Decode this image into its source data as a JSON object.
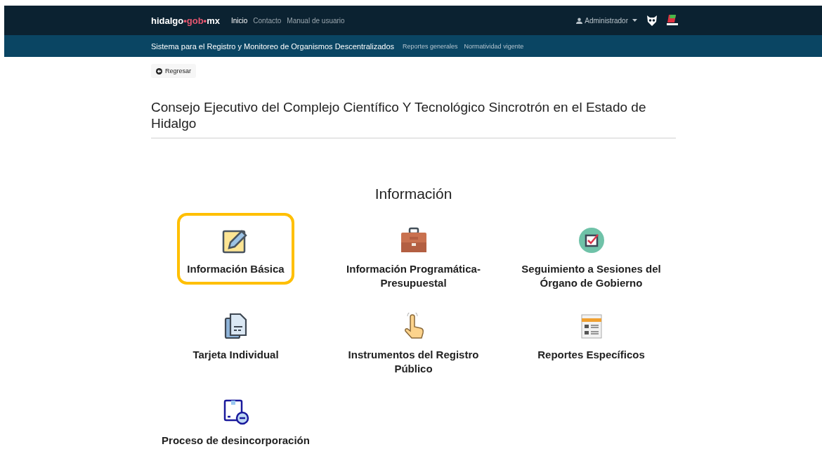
{
  "header": {
    "logo": [
      {
        "text": "hidalgo",
        "color": "#ffffff"
      },
      {
        "text": "•gob•",
        "color": "#e5566f"
      },
      {
        "text": "mx",
        "color": "#ffffff"
      }
    ],
    "nav": [
      {
        "label": "Inicio",
        "selected": true
      },
      {
        "label": "Contacto",
        "selected": false
      },
      {
        "label": "Manual de usuario",
        "selected": false
      }
    ],
    "user": "Administrador"
  },
  "subheader": {
    "title": "Sistema para el Registro y Monitoreo de Organismos Descentralizados",
    "links": [
      "Reportes generales",
      "Normatividad vigente"
    ]
  },
  "back_button": "Regresar",
  "page_title": "Consejo Ejecutivo del Complejo Científico Y Tecnológico Sincrotrón en el Estado de Hidalgo",
  "section_title": "Información",
  "cards": [
    {
      "label": "Información Básica",
      "kind": "pencil",
      "selected": true
    },
    {
      "label": "Información Programática-Presupuestal",
      "kind": "briefcase",
      "selected": false
    },
    {
      "label": "Seguimiento a Sesiones del Órgano de Gobierno",
      "kind": "check",
      "selected": false
    },
    {
      "label": "Tarjeta Individual",
      "kind": "document",
      "selected": false
    },
    {
      "label": "Instrumentos del Registro Público",
      "kind": "hand",
      "selected": false
    },
    {
      "label": "Reportes Específicos",
      "kind": "report",
      "selected": false
    },
    {
      "label": "Proceso de desincorporación",
      "kind": "box",
      "selected": false
    }
  ]
}
